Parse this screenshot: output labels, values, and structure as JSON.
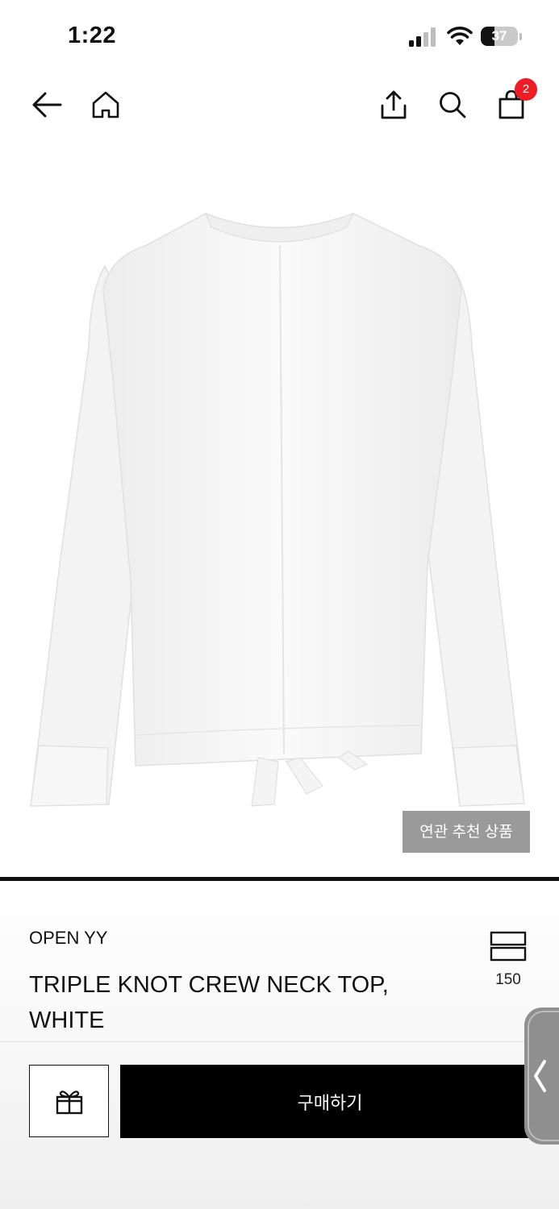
{
  "status_bar": {
    "time": "1:22",
    "battery": "37",
    "battery_level": 0.37
  },
  "nav": {
    "cart_badge": "2"
  },
  "product": {
    "related_button": "연관 추천 상품",
    "brand": "OPEN YY",
    "name": "TRIPLE KNOT CREW NECK TOP, WHITE",
    "layout_count": "150"
  },
  "actions": {
    "buy_label": "구매하기"
  },
  "colors": {
    "accent_badge": "#ee1c25",
    "primary_button": "#000000",
    "related_button_bg": "#9a9a9a"
  },
  "icons": [
    "back-arrow-icon",
    "home-icon",
    "share-icon",
    "search-icon",
    "shopping-bag-icon",
    "grid-layout-icon",
    "gift-icon",
    "chevron-left-icon"
  ]
}
